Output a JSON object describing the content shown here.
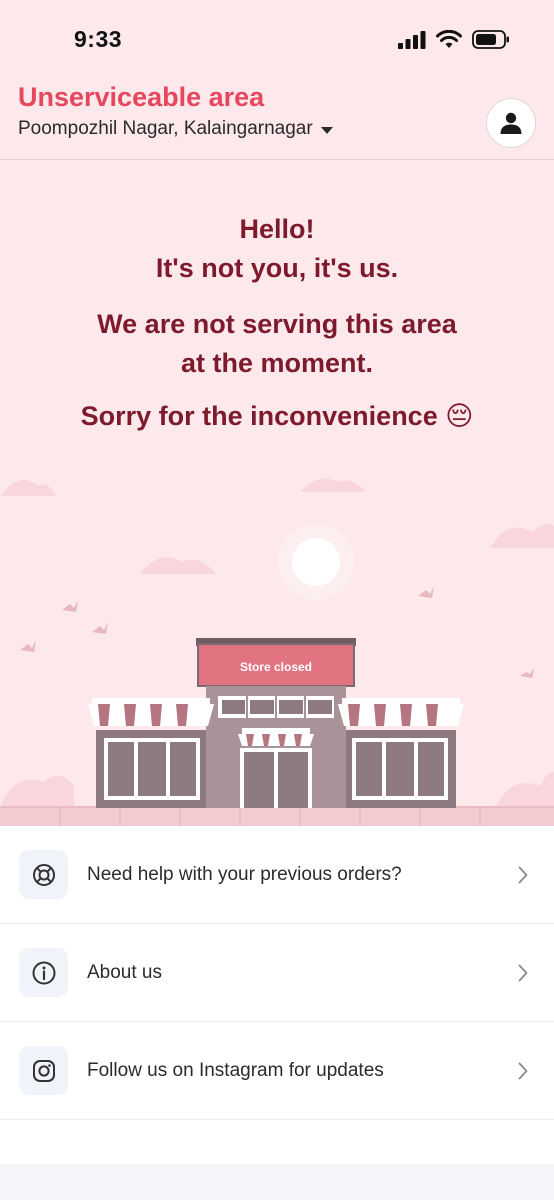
{
  "status_bar": {
    "time": "9:33"
  },
  "header": {
    "title": "Unserviceable area",
    "location": "Poompozhil Nagar, Kalaingarnagar"
  },
  "message": {
    "greeting_line1": "Hello!",
    "greeting_line2": "It's not you, it's us.",
    "notice_line1": "We are not serving this area",
    "notice_line2": "at the moment.",
    "apology": "Sorry for the inconvenience 😔"
  },
  "illustration": {
    "sign_text": "Store closed"
  },
  "menu": {
    "items": [
      {
        "label": "Need help with your previous orders?",
        "icon": "lifebuoy-icon"
      },
      {
        "label": "About us",
        "icon": "info-icon"
      },
      {
        "label": "Follow us on Instagram for updates",
        "icon": "instagram-icon"
      }
    ]
  },
  "colors": {
    "accent": "#e5475e",
    "hero_background": "#fde9ec",
    "message_text": "#7d1a2b"
  }
}
